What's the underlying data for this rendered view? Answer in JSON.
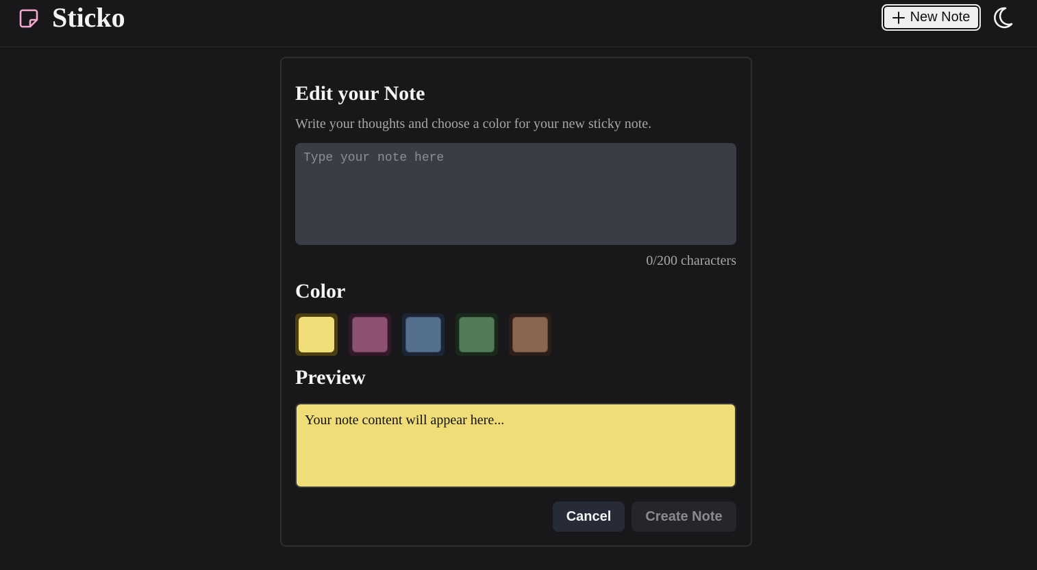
{
  "header": {
    "brand": "Sticko",
    "new_note_label": "New Note",
    "logo_icon": "sticky-note-icon",
    "theme_icon": "moon-icon",
    "logo_color": "#f5a9d0"
  },
  "dialog": {
    "title": "Edit your Note",
    "description": "Write your thoughts and choose a color for your new sticky note.",
    "input": {
      "value": "",
      "placeholder": "Type your note here"
    },
    "char_count": "0/200 characters",
    "color_label": "Color",
    "colors": [
      {
        "name": "yellow",
        "fill": "#f0dd78",
        "ring": "#4a3e12",
        "selected": true
      },
      {
        "name": "pink",
        "fill": "#8d5272",
        "ring": "#33182a",
        "selected": false
      },
      {
        "name": "blue",
        "fill": "#55708f",
        "ring": "#1b2535",
        "selected": false
      },
      {
        "name": "green",
        "fill": "#527b57",
        "ring": "#18281b",
        "selected": false
      },
      {
        "name": "brown",
        "fill": "#8a654f",
        "ring": "#2b1e18",
        "selected": false
      }
    ],
    "preview_label": "Preview",
    "preview_text": "Your note content will appear here...",
    "preview_color": "#f0dd78",
    "cancel_label": "Cancel",
    "create_label": "Create Note"
  }
}
